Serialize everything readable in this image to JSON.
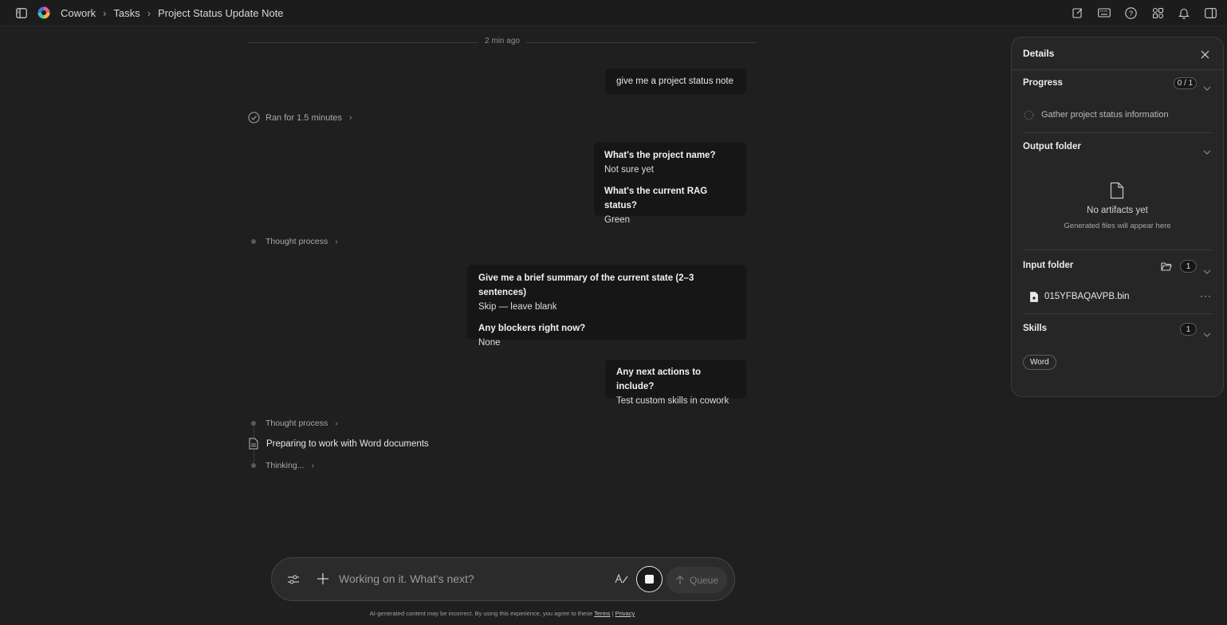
{
  "breadcrumb": {
    "app": "Cowork",
    "section": "Tasks",
    "page": "Project Status Update Note"
  },
  "chat": {
    "timestamp": "2 min ago",
    "user_prompt": "give me a project status note",
    "ran_for": "Ran for 1.5 minutes",
    "qa_block_1": [
      {
        "q": "What's the project name?",
        "a": "Not sure yet"
      },
      {
        "q": "What's the current RAG status?",
        "a": "Green"
      }
    ],
    "thought_process_1": "Thought process",
    "qa_block_2": [
      {
        "q": "Give me a brief summary of the current state (2–3 sentences)",
        "a": "Skip — leave blank"
      },
      {
        "q": "Any blockers right now?",
        "a": "None"
      }
    ],
    "qa_block_3": [
      {
        "q": "Any next actions to include?",
        "a": "Test custom skills in cowork"
      }
    ],
    "thought_process_2": "Thought process",
    "preparing": "Preparing to work with Word documents",
    "thinking": "Thinking..."
  },
  "composer": {
    "placeholder": "Working on it. What's next?",
    "queue_label": "Queue"
  },
  "footer": {
    "disclaimer": "AI-generated content may be incorrect. By using this experience, you agree to these",
    "terms": "Terms",
    "sep": "|",
    "privacy": "Privacy"
  },
  "details": {
    "title": "Details",
    "progress": {
      "label": "Progress",
      "count": "0 / 1",
      "task": "Gather project status information"
    },
    "output": {
      "label": "Output folder",
      "empty_title": "No artifacts yet",
      "empty_sub": "Generated files will appear here"
    },
    "input": {
      "label": "Input folder",
      "count": "1",
      "file": "015YFBAQAVPB.bin"
    },
    "skills": {
      "label": "Skills",
      "count": "1",
      "chip": "Word"
    }
  }
}
